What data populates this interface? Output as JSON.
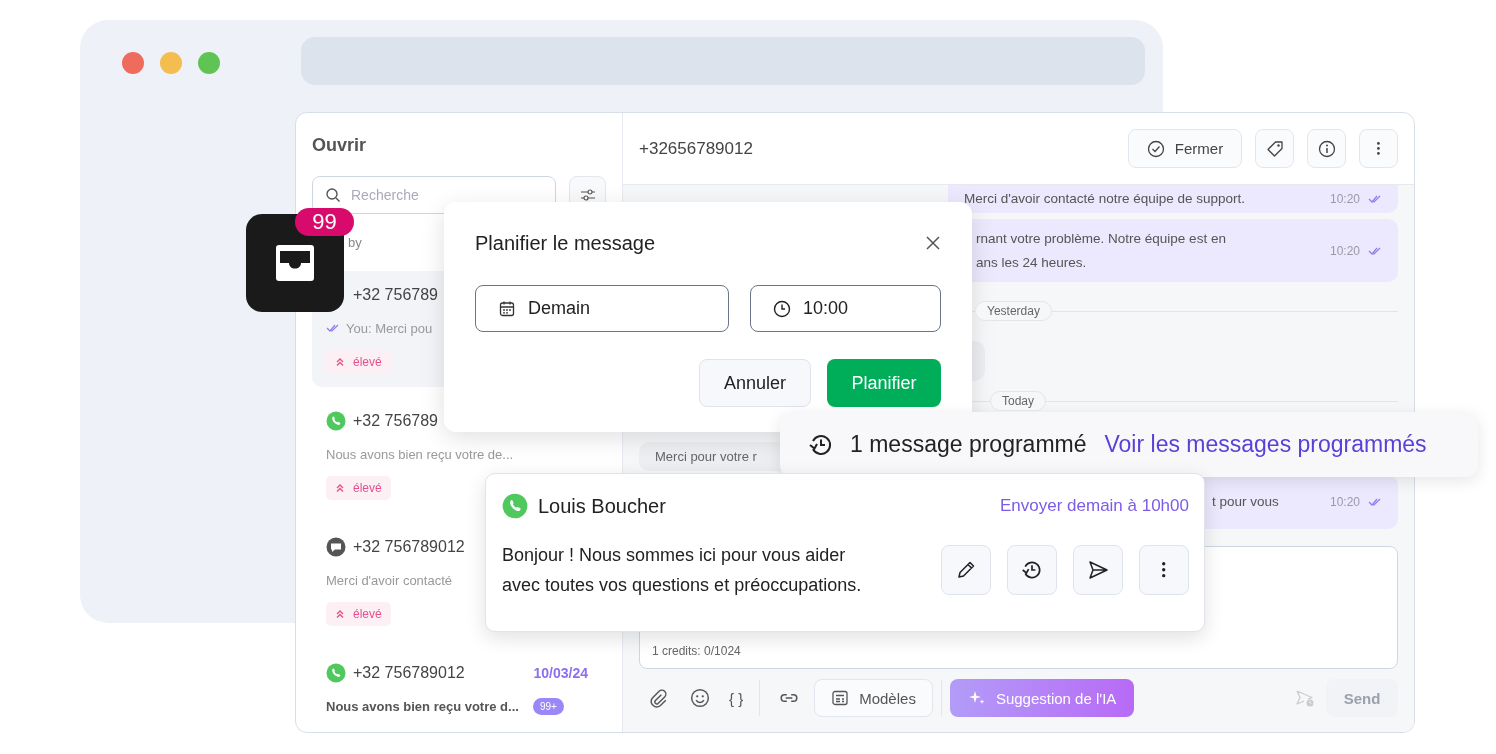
{
  "app_icon": {
    "badge": "99"
  },
  "sidebar": {
    "title": "Ouvrir",
    "search": {
      "placeholder": "Recherche"
    },
    "sort_label": "by",
    "conversations": [
      {
        "phone": "+32 756789",
        "preview": "You: Merci pou",
        "read": true,
        "tag": "élevé",
        "selected": true
      },
      {
        "kind": "whatsapp",
        "phone": "+32 756789",
        "preview": "Nous avons bien reçu votre de...",
        "read": false,
        "tag": "élevé",
        "selected": false
      },
      {
        "kind": "sms",
        "phone": "+32 756789012",
        "preview": "Merci d'avoir contacté",
        "read": false,
        "tag": "élevé",
        "selected": false
      },
      {
        "kind": "whatsapp",
        "phone": "+32 756789012",
        "date": "10/03/24",
        "preview": "Nous avons bien reçu votre d...",
        "unread": "99+",
        "read": false,
        "selected": false
      }
    ]
  },
  "chat": {
    "contact": "+32656789012",
    "close_button": "Fermer",
    "messages": [
      {
        "kind": "outgoing",
        "lines": [
          "Merci d'avoir contacté notre équipe de support."
        ],
        "time": "10:20"
      },
      {
        "kind": "outgoing",
        "lines": [
          "rnant votre problème. Notre équipe est en",
          "ans les 24 heures."
        ],
        "time": "10:20"
      },
      {
        "kind": "date",
        "label": "Yesterday"
      },
      {
        "kind": "incoming"
      },
      {
        "kind": "date",
        "label": "Today"
      },
      {
        "kind": "incoming",
        "lines": [
          "Merci pour votre r"
        ]
      },
      {
        "kind": "outgoing",
        "lines": [
          "t pour vous"
        ],
        "time": "10:20"
      }
    ],
    "composer": {
      "counter": "1 credits: 0/1024",
      "variables_label": "{ }",
      "templates_button": "Modèles",
      "ai_button": "Suggestion de l'IA",
      "send_button": "Send",
      "send_disabled": true
    }
  },
  "schedule_dialog": {
    "title": "Planifier le message",
    "date": "Demain",
    "time": "10:00",
    "cancel_button": "Annuler",
    "confirm_button": "Planifier"
  },
  "scheduled_banner": {
    "text": "1 message programmé",
    "link": "Voir les messages programmés"
  },
  "scheduled_message": {
    "kind": "whatsapp",
    "contact": "Louis Boucher",
    "send_time": "Envoyer demain à 10h00",
    "lines": [
      "Bonjour ! Nous sommes ici pour vous aider",
      "avec toutes vos questions et préoccupations."
    ]
  }
}
